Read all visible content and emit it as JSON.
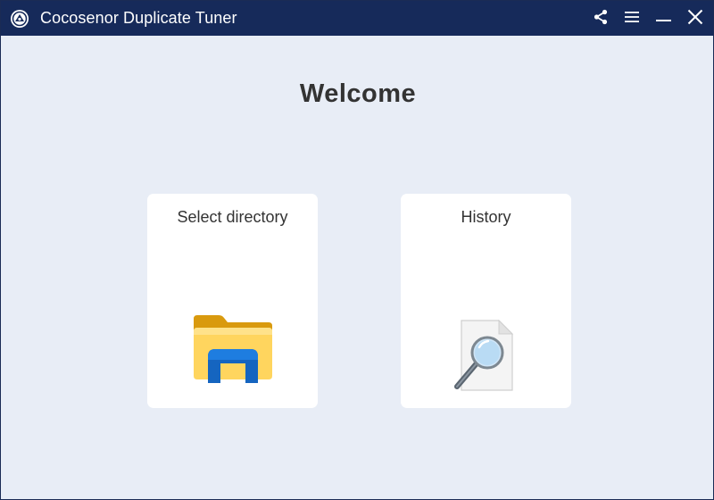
{
  "window": {
    "title": "Cocosenor Duplicate Tuner",
    "logo_icon": "app-logo-icon",
    "buttons": [
      "share-icon",
      "menu-icon",
      "minimize-icon",
      "close-icon"
    ],
    "colors": {
      "titlebar": "#162a5a",
      "background": "#e8edf6",
      "card": "#ffffff"
    }
  },
  "main": {
    "heading": "Welcome",
    "cards": [
      {
        "label": "Select directory",
        "icon": "folder-icon"
      },
      {
        "label": "History",
        "icon": "search-document-icon"
      }
    ]
  }
}
